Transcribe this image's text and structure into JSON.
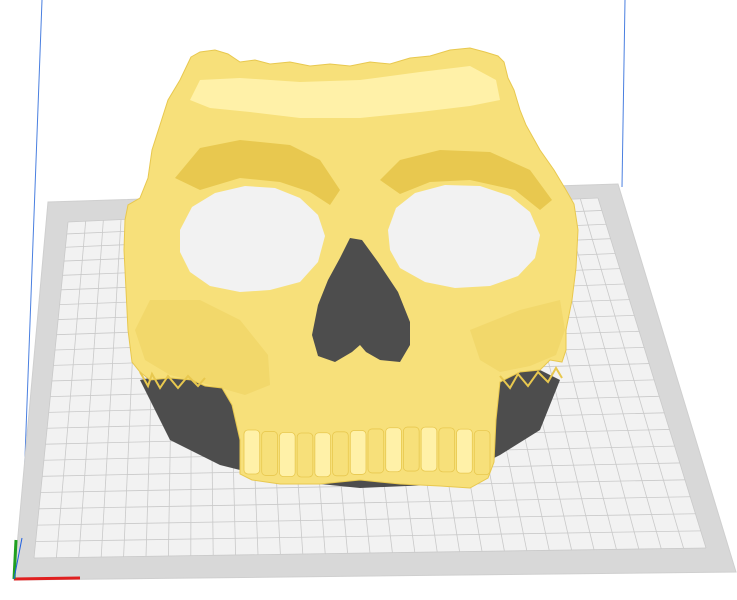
{
  "scene": {
    "background_color": "#ffffff",
    "build_plate": {
      "outer_border_color": "#d8d8d8",
      "plate_color": "#f2f2f2",
      "grid_color": "#c9c9c9",
      "edge_color": "#cfcfcf"
    },
    "volume_edges": {
      "color": "#4a7fe0"
    },
    "model": {
      "name": "skull mask",
      "color": "#f7e07a",
      "highlight_color": "#fff1a8",
      "shade_color": "#e8c84f",
      "shadow_color": "#4d4d4d"
    },
    "axes_gizmo": {
      "x_color": "#e02020",
      "y_color": "#20a020",
      "z_color": "#2060e0"
    }
  }
}
